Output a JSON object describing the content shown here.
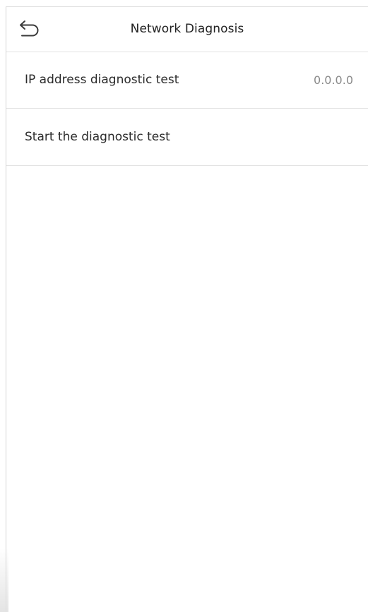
{
  "header": {
    "title": "Network Diagnosis",
    "back_icon": "back-arrow-icon"
  },
  "menu": {
    "items": [
      {
        "label": "IP address diagnostic test",
        "value": "0.0.0.0"
      },
      {
        "label": "Start the diagnostic test"
      }
    ]
  }
}
